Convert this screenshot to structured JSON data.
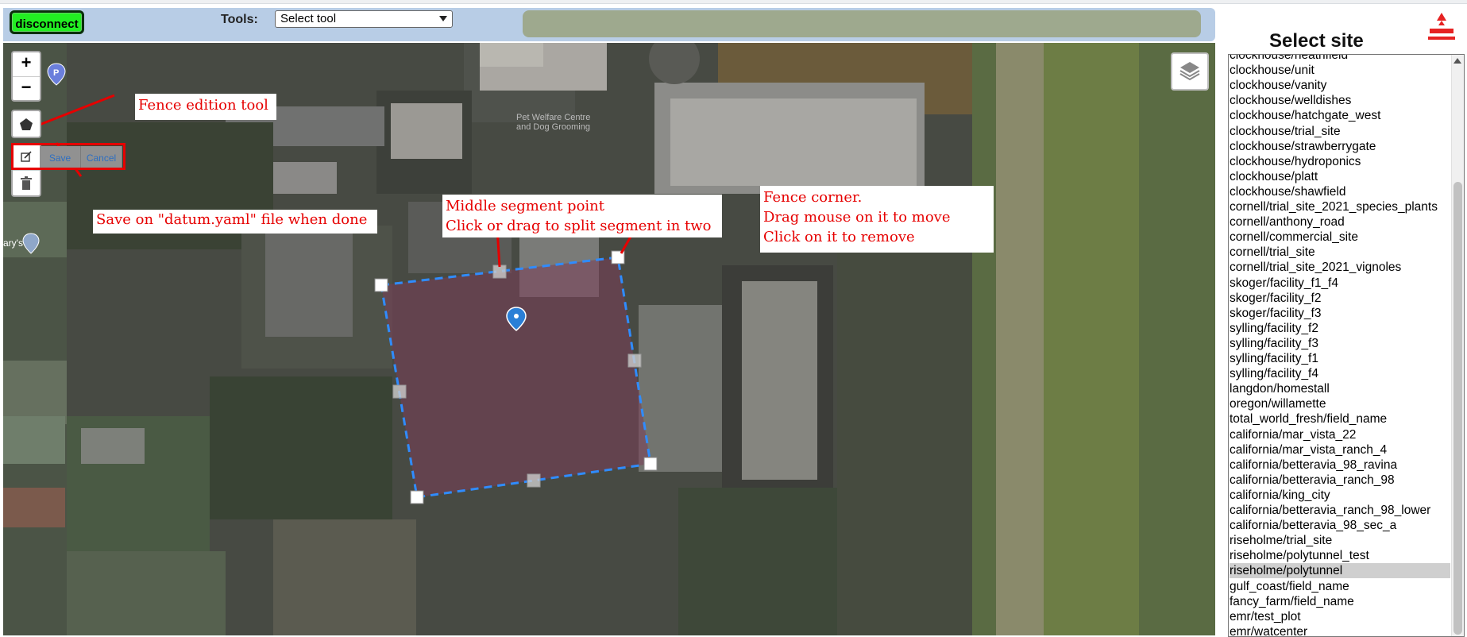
{
  "toolbar": {
    "disconnect_label": "disconnect",
    "tools_label": "Tools:",
    "tool_selected": "Select tool"
  },
  "map": {
    "zoom_in": "+",
    "zoom_out": "−",
    "save_label": "Save",
    "cancel_label": "Cancel",
    "poi_labels": [
      "Pet Welfare Centre",
      "and Dog Grooming",
      "ary's"
    ],
    "annotations": {
      "fence_tool": "Fence edition tool",
      "save_note": "Save on \"datum.yaml\" file when done",
      "middle_point_title": "Middle segment point",
      "middle_point_desc": "Click or drag to split segment in two",
      "corner_title": "Fence corner.",
      "corner_move": "Drag mouse on it to move",
      "corner_remove": "Click on it to remove"
    },
    "colors": {
      "annotation": "#e60000",
      "fence_line": "#2f8cff",
      "fence_fill": "#7a3e58"
    }
  },
  "sidebar": {
    "title": "Select site",
    "selected": "riseholme/polytunnel",
    "sites": [
      "clockhouse/heathfield",
      "clockhouse/unit",
      "clockhouse/vanity",
      "clockhouse/welldishes",
      "clockhouse/hatchgate_west",
      "clockhouse/trial_site",
      "clockhouse/strawberrygate",
      "clockhouse/hydroponics",
      "clockhouse/platt",
      "clockhouse/shawfield",
      "cornell/trial_site_2021_species_plants",
      "cornell/anthony_road",
      "cornell/commercial_site",
      "cornell/trial_site",
      "cornell/trial_site_2021_vignoles",
      "skoger/facility_f1_f4",
      "skoger/facility_f2",
      "skoger/facility_f3",
      "sylling/facility_f2",
      "sylling/facility_f3",
      "sylling/facility_f1",
      "sylling/facility_f4",
      "langdon/homestall",
      "oregon/willamette",
      "total_world_fresh/field_name",
      "california/mar_vista_22",
      "california/mar_vista_ranch_4",
      "california/betteravia_98_ravina",
      "california/betteravia_ranch_98",
      "california/king_city",
      "california/betteravia_ranch_98_lower",
      "california/betteravia_98_sec_a",
      "riseholme/trial_site",
      "riseholme/polytunnel_test",
      "riseholme/polytunnel",
      "gulf_coast/field_name",
      "fancy_farm/field_name",
      "emr/test_plot",
      "emr/watcenter"
    ]
  }
}
